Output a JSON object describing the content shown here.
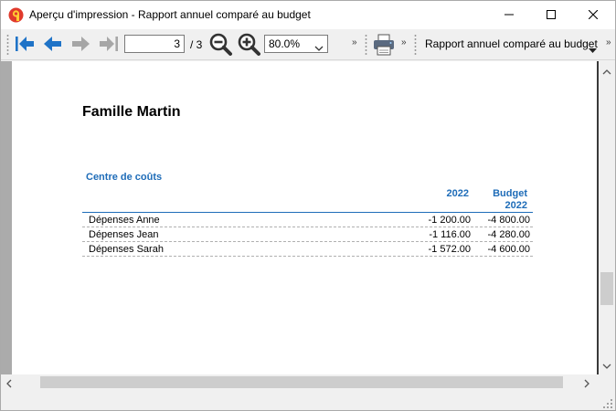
{
  "window": {
    "title": "Aperçu d'impression - Rapport annuel comparé au budget",
    "app_icon": "app-logo-icon",
    "controls": [
      "minimize-icon",
      "maximize-icon",
      "close-icon"
    ]
  },
  "toolbar": {
    "buttons": [
      "first-page-icon",
      "previous-page-icon",
      "next-page-icon",
      "last-page-icon"
    ],
    "page_current": "3",
    "page_total": "/ 3",
    "zoom_out": "zoom-out-icon",
    "zoom_in": "zoom-in-icon",
    "zoom_value": "80.0%",
    "overflow_chevron": "»",
    "print": "printer-icon",
    "report_name": "Rapport annuel comparé au budget"
  },
  "report": {
    "family_title": "Famille Martin",
    "section_title": "Centre de coûts",
    "columns": {
      "year": "2022",
      "budget_line1": "Budget",
      "budget_line2": "2022"
    },
    "rows": [
      {
        "label": "Dépenses Anne",
        "actual": "-1 200.00",
        "budget": "-4 800.00"
      },
      {
        "label": "Dépenses Jean",
        "actual": "-1 116.00",
        "budget": "-4 280.00"
      },
      {
        "label": "Dépenses Sarah",
        "actual": "-1 572.00",
        "budget": "-4 600.00"
      }
    ]
  },
  "colors": {
    "accent_blue": "#1e6cb8",
    "nav_blue": "#1f73c7",
    "nav_disabled": "#a6a6a6",
    "app_icon_red": "#e03a2c"
  }
}
